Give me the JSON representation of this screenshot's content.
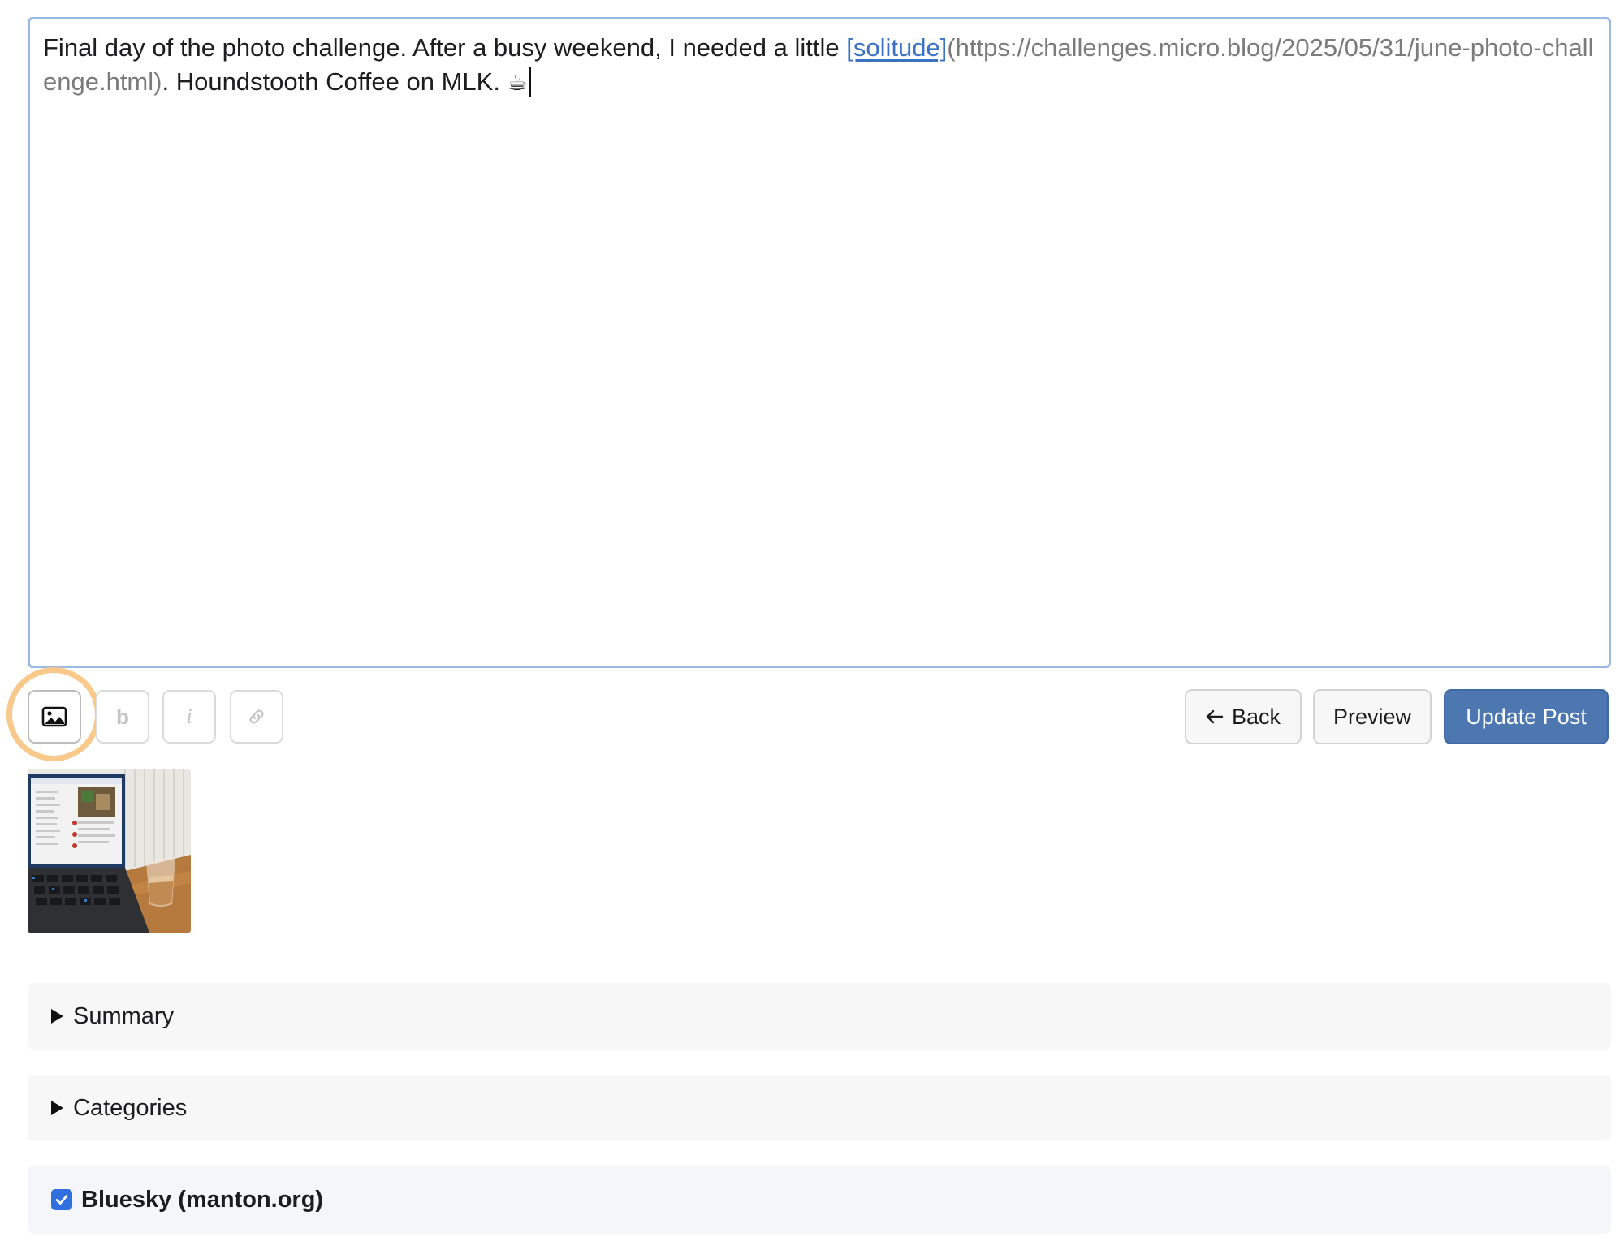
{
  "editor": {
    "text_before": "Final day of the photo challenge. After a busy weekend, I needed a little ",
    "link_text": "[solitude]",
    "link_url": "(https://challenges.micro.blog/2025/05/31/june-photo-challenge.html)",
    "text_after": ". Houndstooth Coffee on MLK. ",
    "emoji": "☕"
  },
  "toolbar": {
    "bold_label": "b",
    "italic_label": "i",
    "icons": [
      "image-icon",
      "link-icon"
    ]
  },
  "actions": {
    "back_label": "Back",
    "back_icon": "arrow-left-icon",
    "preview_label": "Preview",
    "update_label": "Update Post"
  },
  "panels": {
    "summary_label": "Summary",
    "categories_label": "Categories",
    "crosspost_label": "Bluesky (manton.org)",
    "crosspost_checked": true
  },
  "colors": {
    "primary": "#4c77b1",
    "link": "#3a72c4",
    "highlight": "#f8c98a",
    "checkbox": "#2f6fde"
  }
}
